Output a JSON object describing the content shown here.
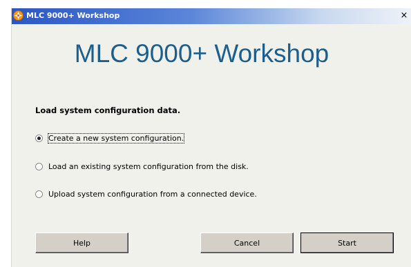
{
  "window": {
    "title": "MLC 9000+ Workshop",
    "close_glyph": "×",
    "icon": "app-logo-icon"
  },
  "banner": {
    "text": "MLC 9000+ Workshop"
  },
  "section": {
    "heading": "Load system configuration data."
  },
  "options": [
    {
      "label": "Create a new system configuration.",
      "selected": true
    },
    {
      "label": "Load an existing system configuration from the disk.",
      "selected": false
    },
    {
      "label": "Upload system configuration from a connected device.",
      "selected": false
    }
  ],
  "buttons": {
    "help": "Help",
    "cancel": "Cancel",
    "start": "Start"
  },
  "colors": {
    "banner_text": "#1c5f8c",
    "titlebar_start": "#2a56c4",
    "dialog_bg": "#f1f1eb"
  }
}
